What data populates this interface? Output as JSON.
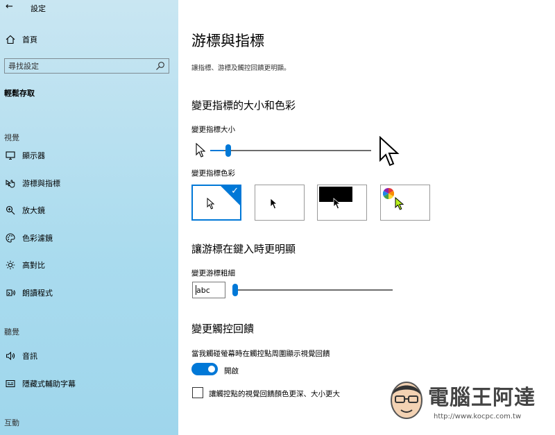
{
  "app": {
    "title": "設定",
    "back_glyph": "←"
  },
  "sidebar": {
    "home_label": "首頁",
    "search_placeholder": "尋找設定",
    "section_title": "輕鬆存取",
    "categories": {
      "vision": "視覺",
      "hearing": "聽覺",
      "interaction": "互動"
    },
    "items": [
      {
        "label": "顯示器",
        "icon": "monitor-icon"
      },
      {
        "label": "游標與指標",
        "icon": "pointer-hand-icon"
      },
      {
        "label": "放大鏡",
        "icon": "magnifier-icon"
      },
      {
        "label": "色彩濾鏡",
        "icon": "palette-icon"
      },
      {
        "label": "高對比",
        "icon": "sun-icon"
      },
      {
        "label": "朗讀程式",
        "icon": "narrator-icon"
      },
      {
        "label": "音訊",
        "icon": "speaker-icon"
      },
      {
        "label": "隱藏式輔助字幕",
        "icon": "caption-icon"
      }
    ]
  },
  "main": {
    "title": "游標與指標",
    "description": "讓指標、游標及觸控回饋更明顯。",
    "size_color_heading": "變更指標的大小和色彩",
    "size_label": "變更指標大小",
    "size_value": 0.1,
    "color_label": "變更指標色彩",
    "color_options": [
      {
        "name": "white",
        "selected": true
      },
      {
        "name": "black",
        "selected": false
      },
      {
        "name": "inverted",
        "selected": false
      },
      {
        "name": "custom",
        "selected": false
      }
    ],
    "cursor_heading": "讓游標在鍵入時更明顯",
    "cursor_thickness_label": "變更游標粗細",
    "cursor_preview_text": "abc",
    "cursor_thickness_value": 0.0,
    "touch_heading": "變更觸控回饋",
    "touch_feedback_label": "當我觸碰螢幕時在觸控點周圍顯示視覺回饋",
    "toggle_state_label": "開啟",
    "toggle_on": true,
    "darker_checkbox_label": "讓觸控點的視覺回饋顏色更深、大小更大",
    "darker_checked": false,
    "accent_color": "#0078d7"
  },
  "watermark": {
    "brand": "電腦王阿達",
    "url": "http://www.kocpc.com.tw"
  }
}
